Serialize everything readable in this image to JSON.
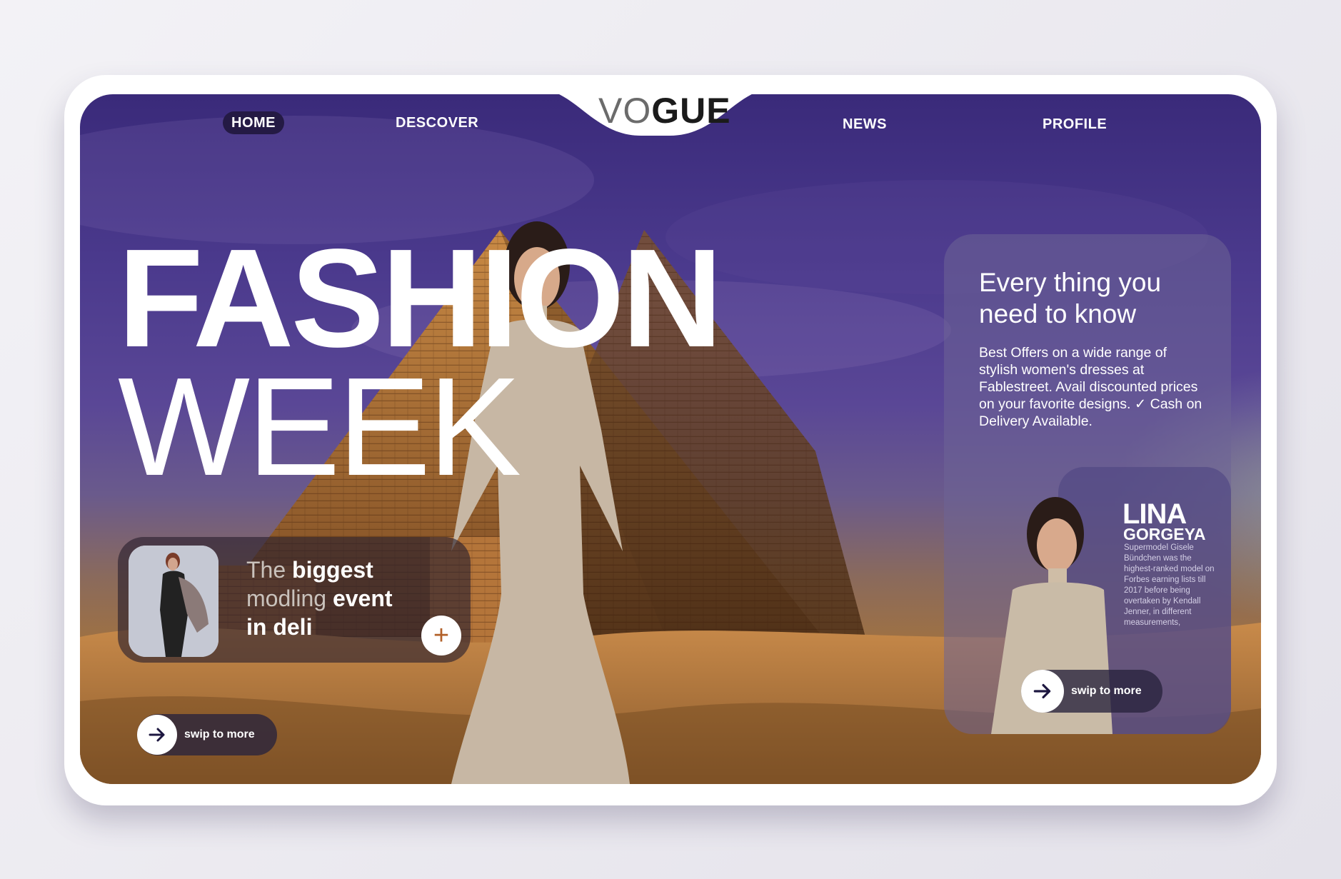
{
  "nav": {
    "logo_part1": "VO",
    "logo_part2": "GUE",
    "items": [
      {
        "label": "HOME",
        "active": true
      },
      {
        "label": "DESCOVER",
        "active": false
      },
      {
        "label": "NEWS",
        "active": false
      },
      {
        "label": "PROFILE",
        "active": false
      }
    ]
  },
  "hero": {
    "line1": "FASHION",
    "line2": "WEEK"
  },
  "event": {
    "word1": "The",
    "word2": "biggest",
    "word3": "modling",
    "word4": "event",
    "word5": "in deli",
    "plus_glyph": "+"
  },
  "swipe": {
    "left_label": "swip to more",
    "right_label": "swip to more"
  },
  "info": {
    "title": "Every thing you need to know",
    "body": "Best Offers on a wide range of stylish women's dresses at Fablestreet. Avail discounted prices on your favorite designs. ✓ Cash on Delivery Available."
  },
  "model": {
    "first_name": "LINA",
    "last_name": "GORGEYA",
    "bio": "Supermodel Gisele Bündchen was the highest-ranked model on Forbes earning lists till 2017 before being overtaken by Kendall Jenner, in different measurements,"
  },
  "colors": {
    "sky": "#3a2a7a",
    "sand": "#a4733c",
    "nav_active": "#241a44",
    "plus_accent": "#b2612a"
  }
}
